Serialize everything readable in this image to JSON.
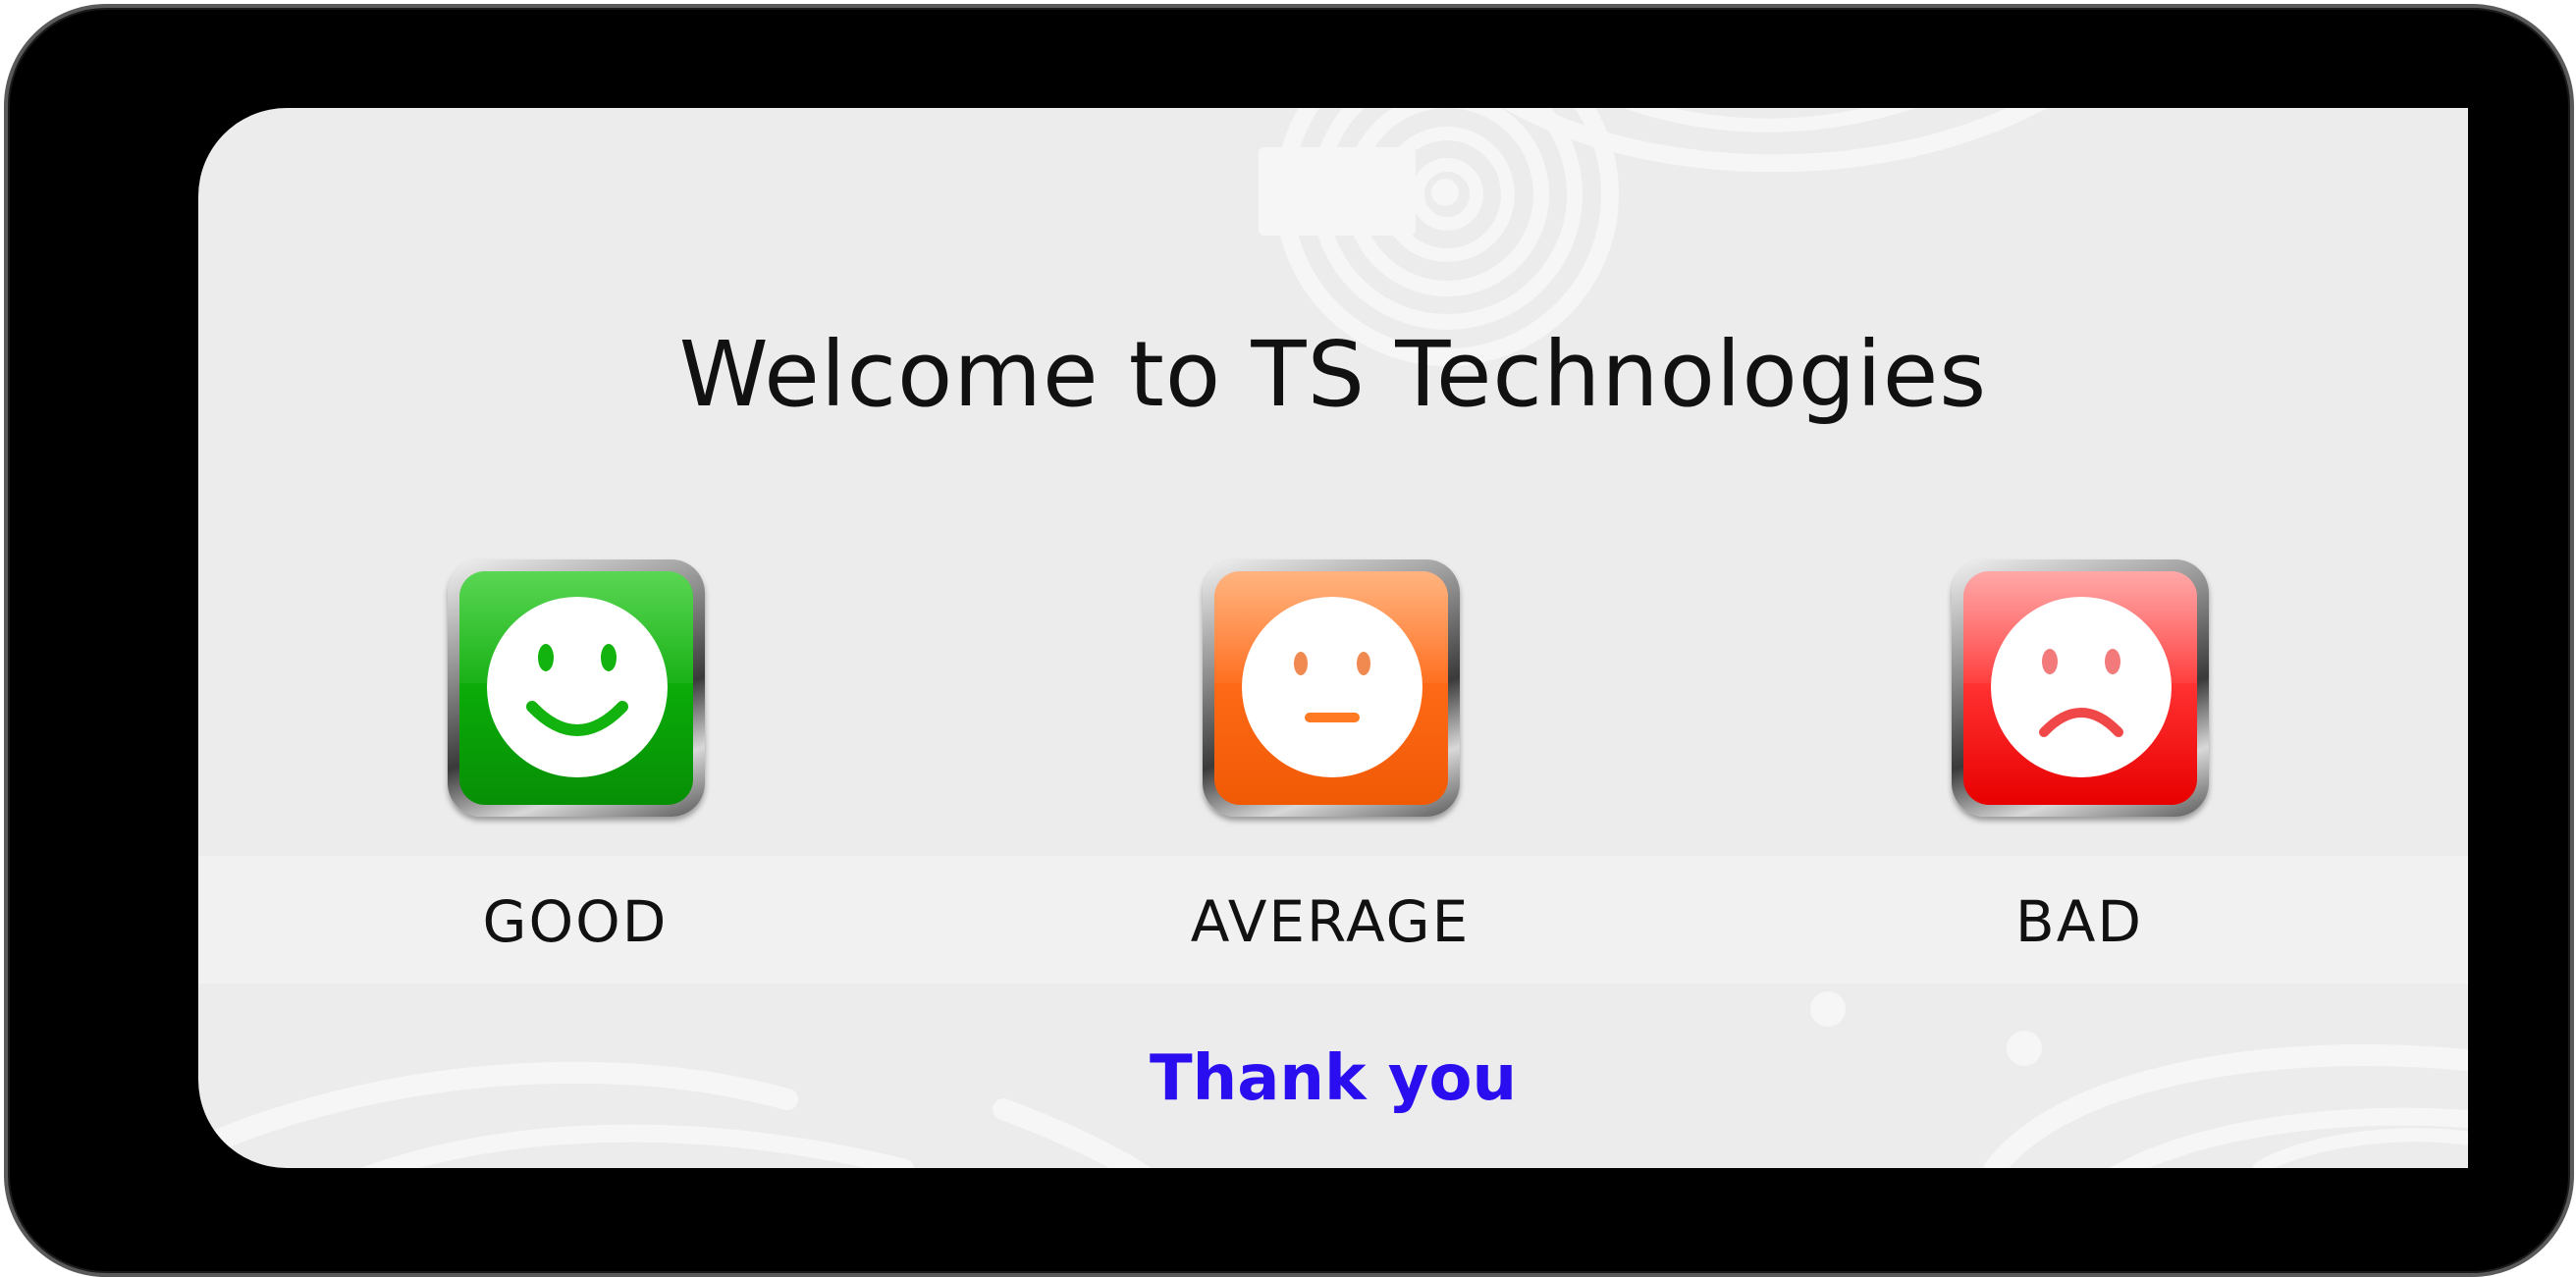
{
  "screen": {
    "title": "Welcome to TS Technologies",
    "footer_text": "Thank you"
  },
  "options": [
    {
      "id": "good",
      "label": "GOOD",
      "icon": "smile-face-icon",
      "color": "#0aa808"
    },
    {
      "id": "average",
      "label": "AVERAGE",
      "icon": "neutral-face-icon",
      "color": "#ff6a18"
    },
    {
      "id": "bad",
      "label": "BAD",
      "icon": "sad-face-icon",
      "color": "#ff1a1a"
    }
  ],
  "colors": {
    "background": "#ececec",
    "bezel": "#000000",
    "footer_text": "#2a0ef0",
    "title_text": "#111111"
  }
}
